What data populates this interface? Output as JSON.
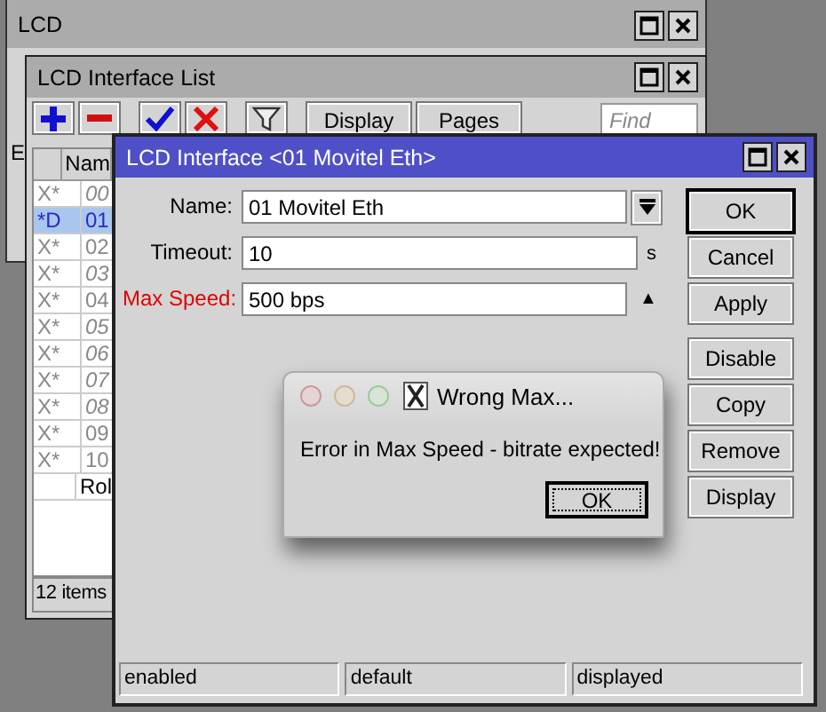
{
  "lcd_window": {
    "title": "LCD",
    "partial_label": "E"
  },
  "list_window": {
    "title": "LCD Interface List",
    "toolbar": [
      {
        "kind": "add"
      },
      {
        "kind": "remove"
      },
      {
        "kind": "enable"
      },
      {
        "kind": "disable"
      },
      {
        "kind": "filter"
      },
      {
        "kind": "text",
        "label": "Display"
      },
      {
        "kind": "text",
        "label": "Pages"
      }
    ],
    "find": {
      "placeholder": "Find"
    },
    "columns": [
      "",
      "Nam"
    ],
    "rows": [
      {
        "flag": "X*",
        "name": "00",
        "selected": false,
        "disabled": true,
        "italic": true
      },
      {
        "flag": "*D",
        "name": "01",
        "selected": true,
        "disabled": false,
        "italic": false
      },
      {
        "flag": "X*",
        "name": "02",
        "selected": false,
        "disabled": true,
        "italic": false
      },
      {
        "flag": "X*",
        "name": "03",
        "selected": false,
        "disabled": true,
        "italic": true
      },
      {
        "flag": "X*",
        "name": "04",
        "selected": false,
        "disabled": true,
        "italic": false
      },
      {
        "flag": "X*",
        "name": "05",
        "selected": false,
        "disabled": true,
        "italic": true
      },
      {
        "flag": "X*",
        "name": "06",
        "selected": false,
        "disabled": true,
        "italic": true
      },
      {
        "flag": "X*",
        "name": "07",
        "selected": false,
        "disabled": true,
        "italic": true
      },
      {
        "flag": "X*",
        "name": "08",
        "selected": false,
        "disabled": true,
        "italic": true
      },
      {
        "flag": "X*",
        "name": "09",
        "selected": false,
        "disabled": true,
        "italic": false
      },
      {
        "flag": "X*",
        "name": "10",
        "selected": false,
        "disabled": true,
        "italic": false
      },
      {
        "flag": "",
        "name": "Rol",
        "selected": false,
        "disabled": false,
        "italic": false
      }
    ],
    "status": "12 items"
  },
  "dialog": {
    "title": "LCD Interface <01 Movitel Eth>",
    "fields": [
      {
        "label": "Name:",
        "value": "01 Movitel Eth",
        "error": false,
        "kind": "dropdown"
      },
      {
        "label": "Timeout:",
        "value": "10",
        "error": false,
        "kind": "unit",
        "suffix": "s"
      },
      {
        "label": "Max Speed:",
        "value": "500 bps",
        "error": true,
        "kind": "spinner",
        "suffix": "▲"
      }
    ],
    "buttons": [
      {
        "label": "OK",
        "default": true
      },
      {
        "label": "Cancel",
        "default": false
      },
      {
        "label": "Apply",
        "default": false
      },
      {
        "label": "Disable",
        "default": false
      },
      {
        "label": "Copy",
        "default": false
      },
      {
        "label": "Remove",
        "default": false
      },
      {
        "label": "Display",
        "default": false
      }
    ],
    "status_bar": [
      "enabled",
      "default",
      "displayed"
    ]
  },
  "alert": {
    "title": "Wrong Max...",
    "message": "Error in Max Speed - bitrate expected!",
    "button": "OK"
  }
}
